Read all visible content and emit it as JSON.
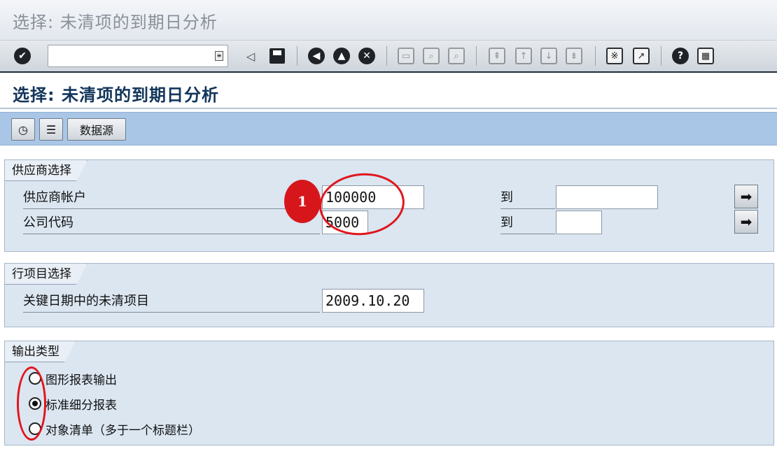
{
  "window_title": "选择: 未清项的到期日分析",
  "screen_title": "选择: 未清项的到期日分析",
  "command_field": {
    "value": ""
  },
  "app_toolbar": {
    "data_source_label": "数据源"
  },
  "vendor_selection": {
    "title": "供应商选择",
    "vendor_account": {
      "label": "供应商帐户",
      "from": "100000",
      "to_label": "到",
      "to": ""
    },
    "company_code": {
      "label": "公司代码",
      "from": "5000",
      "to_label": "到",
      "to": ""
    }
  },
  "line_item_selection": {
    "title": "行项目选择",
    "key_date": {
      "label": "关键日期中的未清项目",
      "value": "2009.10.20"
    }
  },
  "output_type": {
    "title": "输出类型",
    "options": [
      {
        "label": "图形报表输出",
        "selected": false
      },
      {
        "label": "标准细分报表",
        "selected": true
      },
      {
        "label": "对象清单（多于一个标题栏）",
        "selected": false
      }
    ]
  },
  "annotation": {
    "step_number": "1"
  },
  "colors": {
    "accent_red": "#e0161d",
    "header_blue": "#a9c6e6",
    "group_bg": "#dbe6f1",
    "title_text": "#12355b"
  }
}
